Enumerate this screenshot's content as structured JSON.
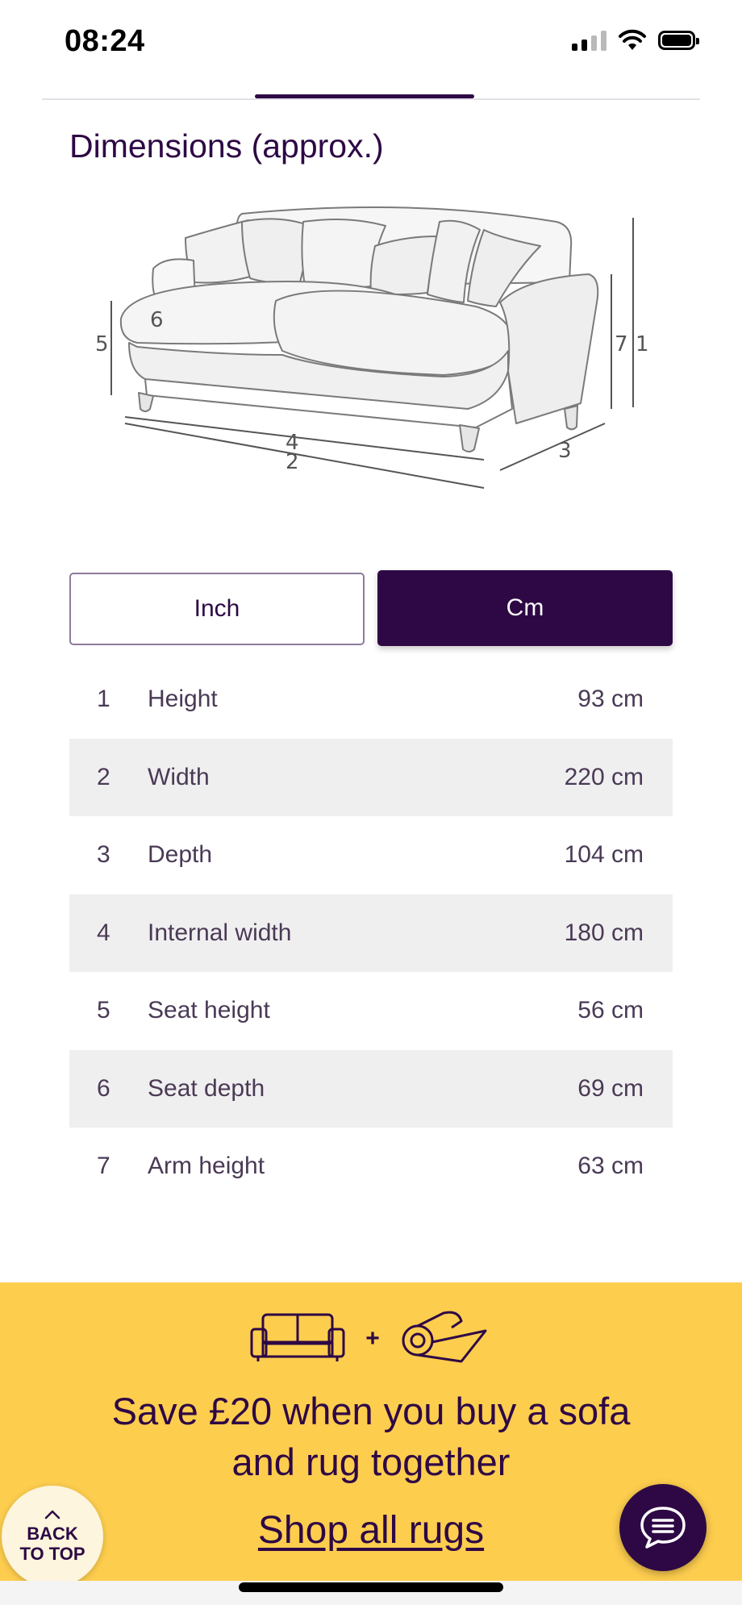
{
  "status_bar": {
    "time": "08:24"
  },
  "section": {
    "title": "Dimensions (approx.)"
  },
  "diagram": {
    "labels": [
      "1",
      "2",
      "3",
      "4",
      "5",
      "6",
      "7"
    ]
  },
  "unit_toggle": {
    "inch_label": "Inch",
    "cm_label": "Cm",
    "selected": "Cm"
  },
  "dimensions": [
    {
      "num": "1",
      "label": "Height",
      "value": "93 cm"
    },
    {
      "num": "2",
      "label": "Width",
      "value": "220 cm"
    },
    {
      "num": "3",
      "label": "Depth",
      "value": "104 cm"
    },
    {
      "num": "4",
      "label": "Internal width",
      "value": "180 cm"
    },
    {
      "num": "5",
      "label": "Seat height",
      "value": "56 cm"
    },
    {
      "num": "6",
      "label": "Seat depth",
      "value": "69 cm"
    },
    {
      "num": "7",
      "label": "Arm height",
      "value": "63 cm"
    }
  ],
  "promo": {
    "plus": "+",
    "line1": "Save £20 when you buy a sofa",
    "line2": "and rug together",
    "link": "Shop all rugs",
    "icons": [
      "sofa-icon",
      "rug-icon"
    ]
  },
  "back_to_top": {
    "line1": "BACK",
    "line2": "TO TOP"
  },
  "colors": {
    "brand": "#2e0845",
    "promo_bg": "#fdcd4e",
    "row_alt": "#f0eff0"
  }
}
